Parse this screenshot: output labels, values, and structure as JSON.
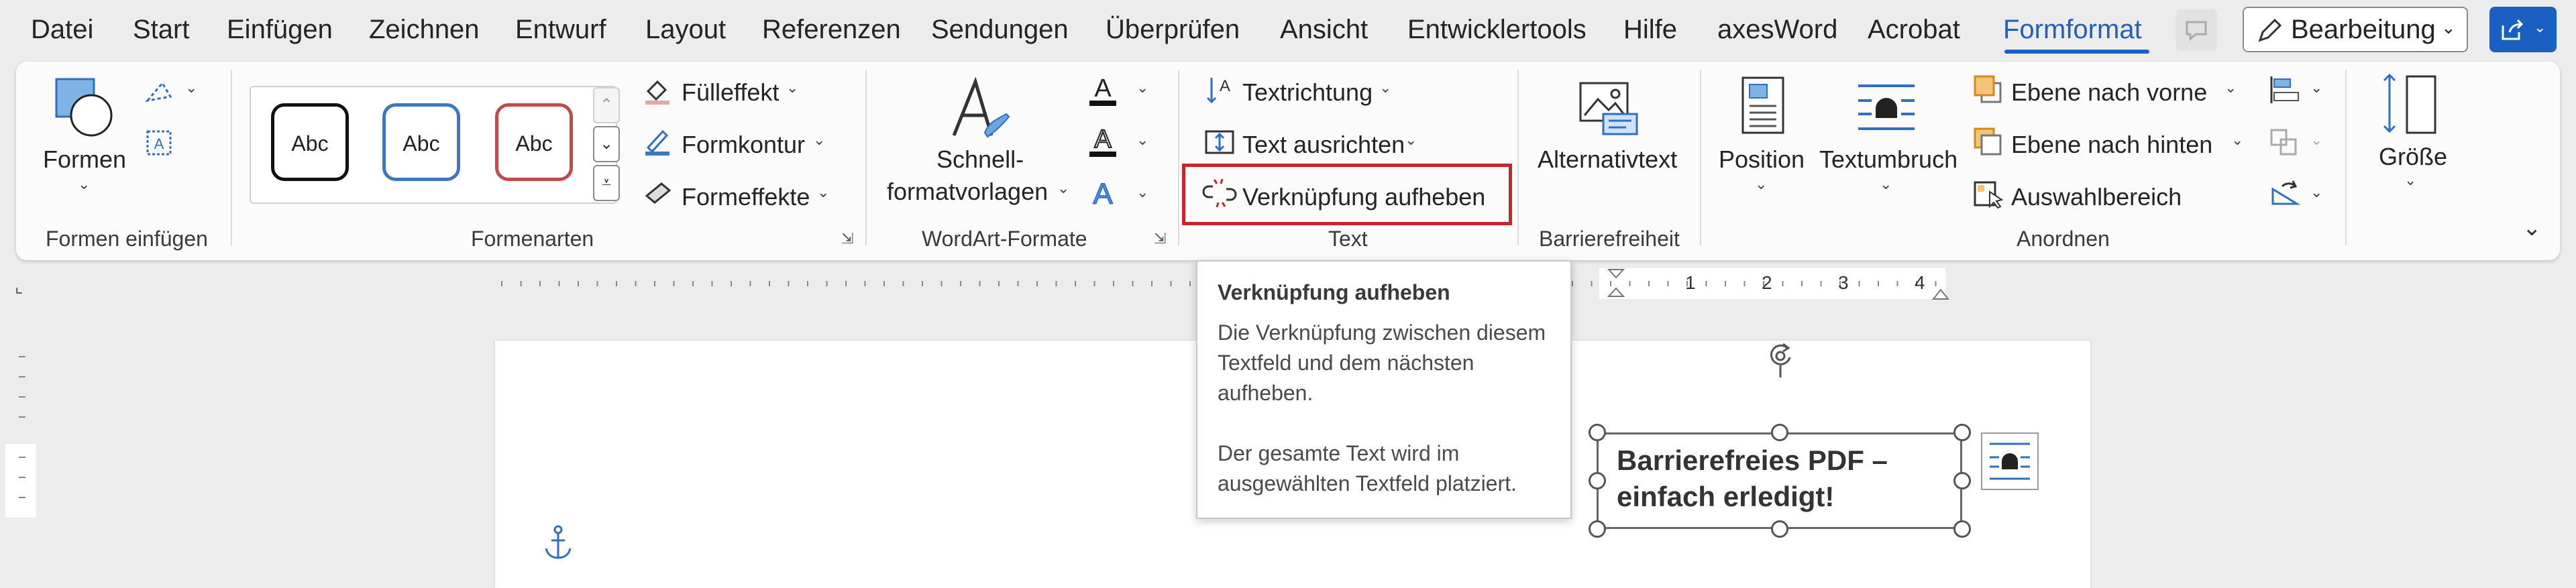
{
  "menu": {
    "items": [
      "Datei",
      "Start",
      "Einfügen",
      "Zeichnen",
      "Entwurf",
      "Layout",
      "Referenzen",
      "Sendungen",
      "Überprüfen",
      "Ansicht",
      "Entwicklertools",
      "Hilfe",
      "axesWord",
      "Acrobat",
      "Formformat"
    ],
    "active": "Formformat",
    "bearbeitung_label": "Bearbeitung"
  },
  "ribbon": {
    "formen_einfuegen": {
      "formen_label": "Formen",
      "group_label": "Formen einfügen"
    },
    "formenarten": {
      "presets": [
        "Abc",
        "Abc",
        "Abc"
      ],
      "fuelleffekt": "Fülleffekt",
      "formkontur": "Formkontur",
      "formeffekte": "Formeffekte",
      "group_label": "Formenarten"
    },
    "wordart": {
      "schnell_line1": "Schnell-",
      "schnell_line2": "formatvorlagen",
      "group_label": "WordArt-Formate"
    },
    "text": {
      "textrichtung": "Textrichtung",
      "text_ausrichten": "Text ausrichten",
      "verknuepfung": "Verknüpfung aufheben",
      "group_label": "Text"
    },
    "barrierefreiheit": {
      "alternativtext": "Alternativtext",
      "group_label": "Barrierefreiheit"
    },
    "anordnen": {
      "position": "Position",
      "textumbruch": "Textumbruch",
      "ebene_vorne": "Ebene nach vorne",
      "ebene_hinten": "Ebene nach hinten",
      "auswahlbereich": "Auswahlbereich",
      "group_label": "Anordnen"
    },
    "groesse": {
      "label": "Größe"
    }
  },
  "ruler": {
    "numbers": [
      "1",
      "2",
      "3",
      "4"
    ]
  },
  "tooltip": {
    "title": "Verknüpfung aufheben",
    "line1": "Die Verknüpfung zwischen diesem",
    "line2": "Textfeld und dem nächsten",
    "line3": "aufheben.",
    "line4": "Der gesamte Text wird im",
    "line5": "ausgewählten Textfeld platziert."
  },
  "textbox": {
    "line1": "Barrierefreies PDF –",
    "line2": "einfach erledigt!"
  },
  "colors": {
    "accent": "#1f5fbf",
    "highlight": "#c4262e",
    "share": "#1a5fc2"
  }
}
